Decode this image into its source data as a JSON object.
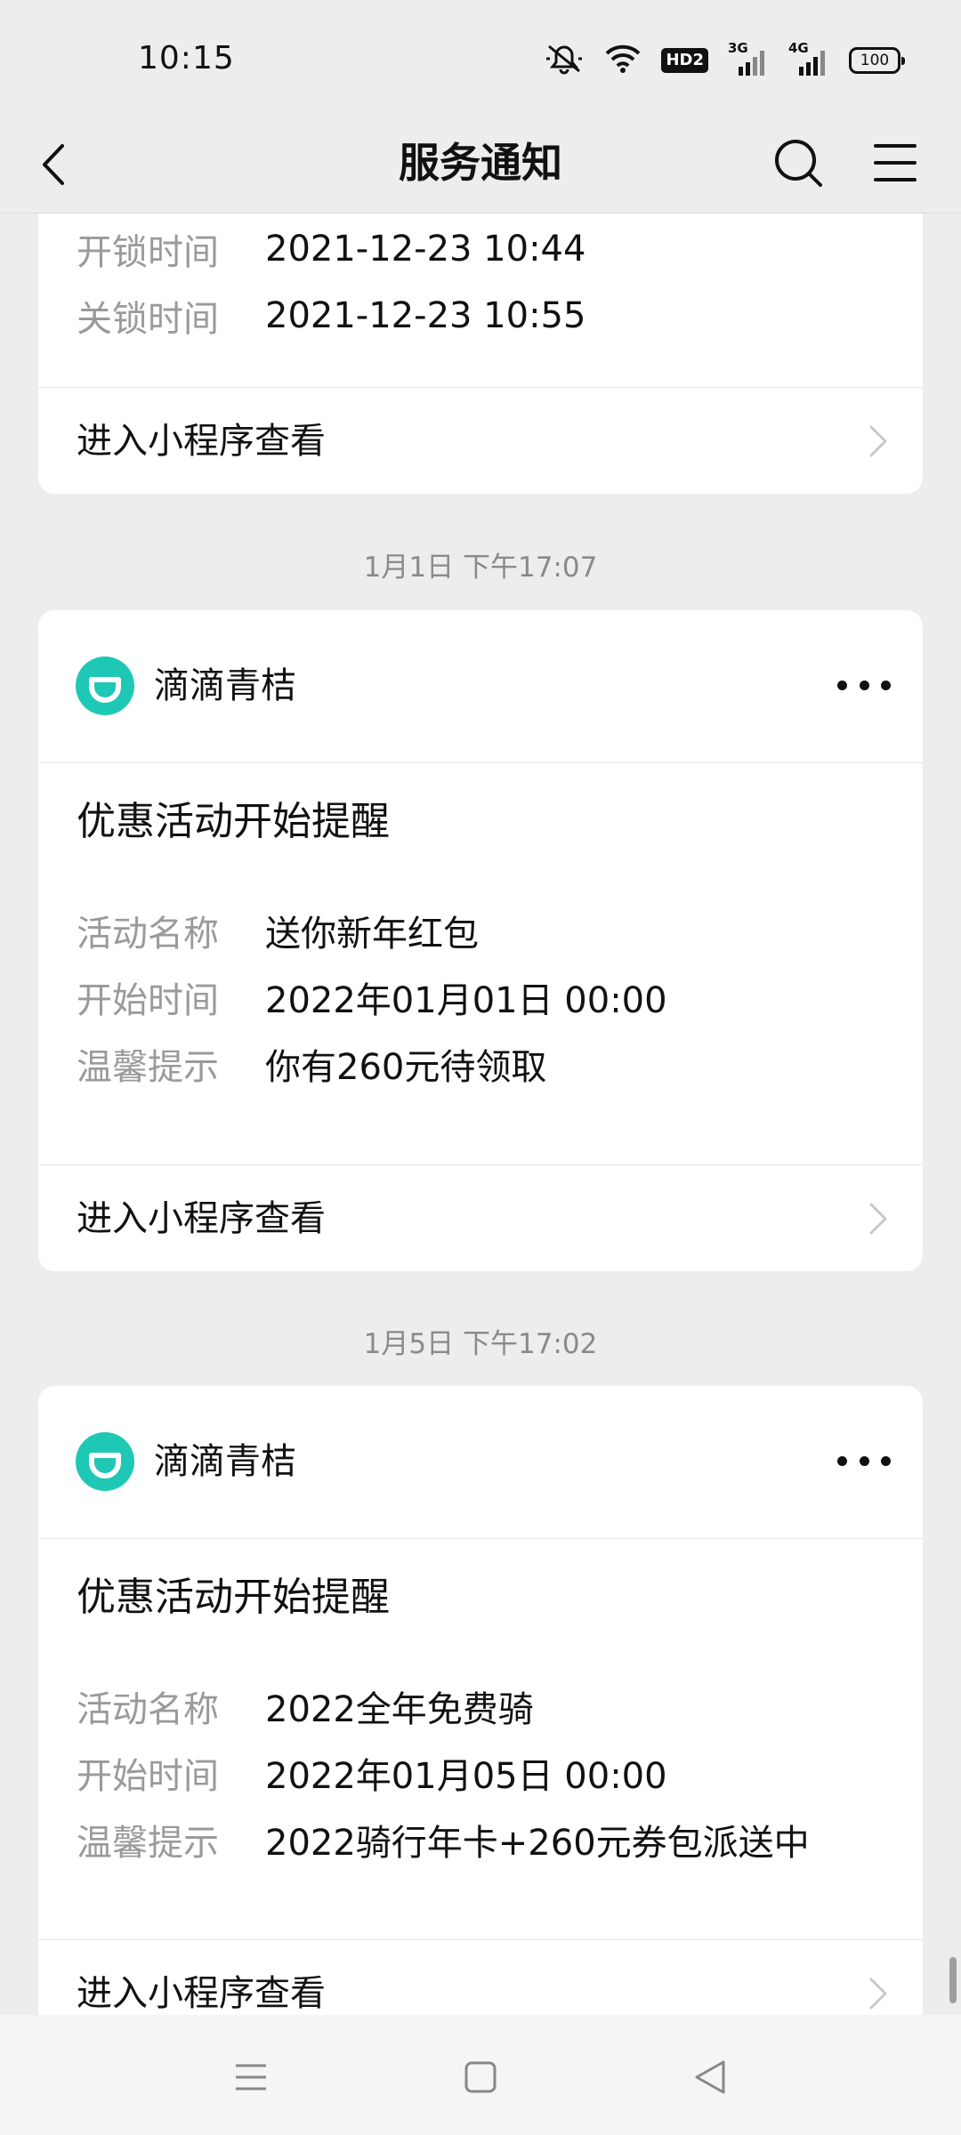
{
  "status_bar": {
    "time": "10:15",
    "icons": [
      "mute-icon",
      "wifi-icon",
      "hd-badge",
      "3g-signal-icon",
      "4g-signal-icon",
      "battery-icon"
    ],
    "hd_label": "HD2",
    "net1_label": "3G",
    "net2_label": "4G",
    "battery_level": "100"
  },
  "nav": {
    "title": "服务通知",
    "back_icon": "chevron-left-icon",
    "search_icon": "search-icon",
    "menu_icon": "menu-icon"
  },
  "cards": [
    {
      "fields": [
        {
          "label": "开锁时间",
          "value": "2021-12-23 10:44"
        },
        {
          "label": "关锁时间",
          "value": "2021-12-23 10:55"
        }
      ],
      "footer": "进入小程序查看"
    },
    {
      "timestamp": "1月1日 下午17:07",
      "app_name": "滴滴青桔",
      "title": "优惠活动开始提醒",
      "fields": [
        {
          "label": "活动名称",
          "value": "送你新年红包"
        },
        {
          "label": "开始时间",
          "value": "2022年01月01日 00:00"
        },
        {
          "label": "温馨提示",
          "value": "你有260元待领取"
        }
      ],
      "footer": "进入小程序查看"
    },
    {
      "timestamp": "1月5日 下午17:02",
      "app_name": "滴滴青桔",
      "title": "优惠活动开始提醒",
      "fields": [
        {
          "label": "活动名称",
          "value": "2022全年免费骑"
        },
        {
          "label": "开始时间",
          "value": "2022年01月05日 00:00"
        },
        {
          "label": "温馨提示",
          "value": "2022骑行年卡+260元券包派送中"
        }
      ],
      "footer": "进入小程序查看"
    }
  ],
  "colors": {
    "background": "#ededed",
    "card": "#ffffff",
    "brand_teal": "#1fc8b4",
    "label_gray": "#9a9a9a"
  }
}
